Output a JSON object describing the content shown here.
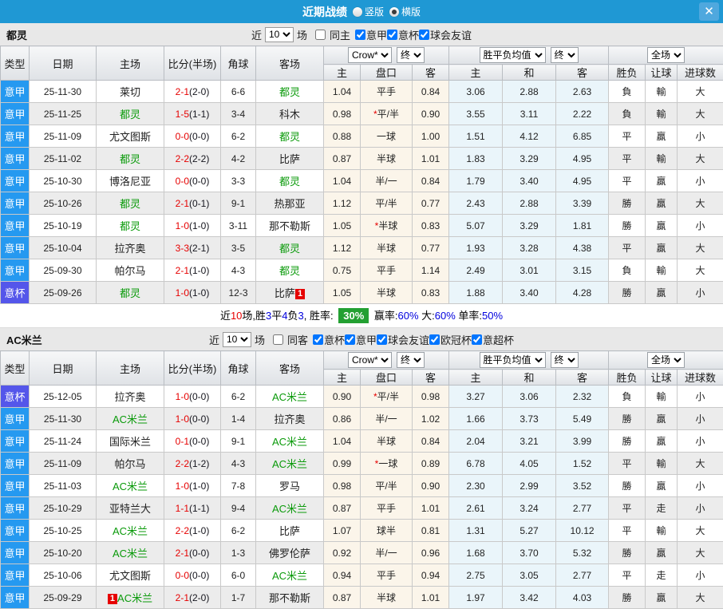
{
  "titlebar": {
    "title": "近期战绩",
    "radio_vertical": "竖版",
    "radio_horizontal": "横版",
    "close_glyph": "✕"
  },
  "table_header": {
    "type": "类型",
    "date": "日期",
    "home": "主场",
    "score": "比分(半场)",
    "corner": "角球",
    "away": "客场",
    "odds_source": "Crow*",
    "odds_final": "终",
    "mean_source": "胜平负均值",
    "mean_final": "终",
    "period": "全场",
    "odds_home": "主",
    "odds_handicap": "盘口",
    "odds_away": "客",
    "mean_home": "主",
    "mean_draw": "和",
    "mean_away": "客",
    "wdl": "胜负",
    "handicap": "让球",
    "goals": "进球数"
  },
  "colors": {
    "titlebar_blue": "#1f98d4",
    "league_badge_blue": "#2599f0",
    "cup_badge_purple": "#5456ea",
    "team_green": "#0a9a0a",
    "win_red": "#d40000",
    "draw_blue": "#2020dd",
    "lose_green": "#0a8a0a",
    "score_red": "#e60000",
    "summary_badge_green": "#23a032",
    "odds_bg": "#fbf5ea",
    "mean_bg": "#eaf5fa"
  },
  "sections": [
    {
      "team": "都灵",
      "filter": {
        "near": "近",
        "count": "10",
        "games": "场",
        "same": {
          "label": "同主",
          "checked": false
        },
        "leagues": [
          {
            "label": "意甲",
            "checked": true
          },
          {
            "label": "意杯",
            "checked": true
          },
          {
            "label": "球会友谊",
            "checked": true
          }
        ]
      },
      "rows": [
        {
          "type": "意甲",
          "type_style": "league",
          "date": "25-11-30",
          "home": "莱切",
          "home_self": false,
          "home_badge": null,
          "score": "2-1",
          "half": "(2-0)",
          "corner": "6-6",
          "away": "都灵",
          "away_self": true,
          "away_badge": null,
          "odds_home": "1.04",
          "handicap": "平手",
          "star": false,
          "odds_away": "0.84",
          "mean_home": "3.06",
          "mean_draw": "2.88",
          "mean_away": "2.63",
          "res_wdl": "負",
          "res_wdl_color": "g",
          "res_hcap": "輸",
          "res_hcap_color": "g",
          "res_goal": "大",
          "res_goal_color": "r"
        },
        {
          "type": "意甲",
          "type_style": "league",
          "date": "25-11-25",
          "home": "都灵",
          "home_self": true,
          "home_badge": null,
          "score": "1-5",
          "half": "(1-1)",
          "corner": "3-4",
          "away": "科木",
          "away_self": false,
          "away_badge": null,
          "odds_home": "0.98",
          "handicap": "平/半",
          "star": true,
          "odds_away": "0.90",
          "mean_home": "3.55",
          "mean_draw": "3.11",
          "mean_away": "2.22",
          "res_wdl": "負",
          "res_wdl_color": "g",
          "res_hcap": "輸",
          "res_hcap_color": "g",
          "res_goal": "大",
          "res_goal_color": "r"
        },
        {
          "type": "意甲",
          "type_style": "league",
          "date": "25-11-09",
          "home": "尤文图斯",
          "home_self": false,
          "home_badge": null,
          "score": "0-0",
          "half": "(0-0)",
          "corner": "6-2",
          "away": "都灵",
          "away_self": true,
          "away_badge": null,
          "odds_home": "0.88",
          "handicap": "一球",
          "star": false,
          "odds_away": "1.00",
          "mean_home": "1.51",
          "mean_draw": "4.12",
          "mean_away": "6.85",
          "res_wdl": "平",
          "res_wdl_color": "b",
          "res_hcap": "贏",
          "res_hcap_color": "r",
          "res_goal": "小",
          "res_goal_color": "g"
        },
        {
          "type": "意甲",
          "type_style": "league",
          "date": "25-11-02",
          "home": "都灵",
          "home_self": true,
          "home_badge": null,
          "score": "2-2",
          "half": "(2-2)",
          "corner": "4-2",
          "away": "比萨",
          "away_self": false,
          "away_badge": null,
          "odds_home": "0.87",
          "handicap": "半球",
          "star": false,
          "odds_away": "1.01",
          "mean_home": "1.83",
          "mean_draw": "3.29",
          "mean_away": "4.95",
          "res_wdl": "平",
          "res_wdl_color": "b",
          "res_hcap": "輸",
          "res_hcap_color": "g",
          "res_goal": "大",
          "res_goal_color": "r"
        },
        {
          "type": "意甲",
          "type_style": "league",
          "date": "25-10-30",
          "home": "博洛尼亚",
          "home_self": false,
          "home_badge": null,
          "score": "0-0",
          "half": "(0-0)",
          "corner": "3-3",
          "away": "都灵",
          "away_self": true,
          "away_badge": null,
          "odds_home": "1.04",
          "handicap": "半/一",
          "star": false,
          "odds_away": "0.84",
          "mean_home": "1.79",
          "mean_draw": "3.40",
          "mean_away": "4.95",
          "res_wdl": "平",
          "res_wdl_color": "b",
          "res_hcap": "贏",
          "res_hcap_color": "r",
          "res_goal": "小",
          "res_goal_color": "g"
        },
        {
          "type": "意甲",
          "type_style": "league",
          "date": "25-10-26",
          "home": "都灵",
          "home_self": true,
          "home_badge": null,
          "score": "2-1",
          "half": "(0-1)",
          "corner": "9-1",
          "away": "热那亚",
          "away_self": false,
          "away_badge": null,
          "odds_home": "1.12",
          "handicap": "平/半",
          "star": false,
          "odds_away": "0.77",
          "mean_home": "2.43",
          "mean_draw": "2.88",
          "mean_away": "3.39",
          "res_wdl": "勝",
          "res_wdl_color": "r",
          "res_hcap": "贏",
          "res_hcap_color": "r",
          "res_goal": "大",
          "res_goal_color": "r"
        },
        {
          "type": "意甲",
          "type_style": "league",
          "date": "25-10-19",
          "home": "都灵",
          "home_self": true,
          "home_badge": null,
          "score": "1-0",
          "half": "(1-0)",
          "corner": "3-11",
          "away": "那不勒斯",
          "away_self": false,
          "away_badge": null,
          "odds_home": "1.05",
          "handicap": "半球",
          "star": true,
          "odds_away": "0.83",
          "mean_home": "5.07",
          "mean_draw": "3.29",
          "mean_away": "1.81",
          "res_wdl": "勝",
          "res_wdl_color": "r",
          "res_hcap": "贏",
          "res_hcap_color": "r",
          "res_goal": "小",
          "res_goal_color": "g"
        },
        {
          "type": "意甲",
          "type_style": "league",
          "date": "25-10-04",
          "home": "拉齐奥",
          "home_self": false,
          "home_badge": null,
          "score": "3-3",
          "half": "(2-1)",
          "corner": "3-5",
          "away": "都灵",
          "away_self": true,
          "away_badge": null,
          "odds_home": "1.12",
          "handicap": "半球",
          "star": false,
          "odds_away": "0.77",
          "mean_home": "1.93",
          "mean_draw": "3.28",
          "mean_away": "4.38",
          "res_wdl": "平",
          "res_wdl_color": "b",
          "res_hcap": "贏",
          "res_hcap_color": "r",
          "res_goal": "大",
          "res_goal_color": "r"
        },
        {
          "type": "意甲",
          "type_style": "league",
          "date": "25-09-30",
          "home": "帕尔马",
          "home_self": false,
          "home_badge": null,
          "score": "2-1",
          "half": "(1-0)",
          "corner": "4-3",
          "away": "都灵",
          "away_self": true,
          "away_badge": null,
          "odds_home": "0.75",
          "handicap": "平手",
          "star": false,
          "odds_away": "1.14",
          "mean_home": "2.49",
          "mean_draw": "3.01",
          "mean_away": "3.15",
          "res_wdl": "負",
          "res_wdl_color": "g",
          "res_hcap": "輸",
          "res_hcap_color": "g",
          "res_goal": "大",
          "res_goal_color": "r"
        },
        {
          "type": "意杯",
          "type_style": "cup",
          "date": "25-09-26",
          "home": "都灵",
          "home_self": true,
          "home_badge": null,
          "score": "1-0",
          "half": "(1-0)",
          "corner": "12-3",
          "away": "比萨",
          "away_self": false,
          "away_badge": {
            "text": "1",
            "pos": "after"
          },
          "odds_home": "1.05",
          "handicap": "半球",
          "star": false,
          "odds_away": "0.83",
          "mean_home": "1.88",
          "mean_draw": "3.40",
          "mean_away": "4.28",
          "res_wdl": "勝",
          "res_wdl_color": "r",
          "res_hcap": "贏",
          "res_hcap_color": "r",
          "res_goal": "小",
          "res_goal_color": "g"
        }
      ],
      "summary": {
        "segments": [
          {
            "text": "近",
            "color": "black"
          },
          {
            "text": "10",
            "color": "red"
          },
          {
            "text": "场,胜",
            "color": "black"
          },
          {
            "text": "3",
            "color": "blue"
          },
          {
            "text": "平",
            "color": "black"
          },
          {
            "text": "4",
            "color": "blue"
          },
          {
            "text": "负",
            "color": "black"
          },
          {
            "text": "3",
            "color": "blue"
          },
          {
            "text": ", 胜率: ",
            "color": "black"
          },
          {
            "text": "30%",
            "color": "badge"
          },
          {
            "text": " 赢率:",
            "color": "black"
          },
          {
            "text": "60%",
            "color": "blue"
          },
          {
            "text": " 大:",
            "color": "black"
          },
          {
            "text": "60%",
            "color": "blue"
          },
          {
            "text": " 单率:",
            "color": "black"
          },
          {
            "text": "50%",
            "color": "blue"
          }
        ]
      }
    },
    {
      "team": "AC米兰",
      "filter": {
        "near": "近",
        "count": "10",
        "games": "场",
        "same": {
          "label": "同客",
          "checked": false
        },
        "leagues": [
          {
            "label": "意杯",
            "checked": true
          },
          {
            "label": "意甲",
            "checked": true
          },
          {
            "label": "球会友谊",
            "checked": true
          },
          {
            "label": "欧冠杯",
            "checked": true
          },
          {
            "label": "意超杯",
            "checked": true
          }
        ]
      },
      "rows": [
        {
          "type": "意杯",
          "type_style": "cup",
          "date": "25-12-05",
          "home": "拉齐奥",
          "home_self": false,
          "home_badge": null,
          "score": "1-0",
          "half": "(0-0)",
          "corner": "6-2",
          "away": "AC米兰",
          "away_self": true,
          "away_badge": null,
          "odds_home": "0.90",
          "handicap": "平/半",
          "star": true,
          "odds_away": "0.98",
          "mean_home": "3.27",
          "mean_draw": "3.06",
          "mean_away": "2.32",
          "res_wdl": "負",
          "res_wdl_color": "g",
          "res_hcap": "輸",
          "res_hcap_color": "g",
          "res_goal": "小",
          "res_goal_color": "g"
        },
        {
          "type": "意甲",
          "type_style": "league",
          "date": "25-11-30",
          "home": "AC米兰",
          "home_self": true,
          "home_badge": null,
          "score": "1-0",
          "half": "(0-0)",
          "corner": "1-4",
          "away": "拉齐奥",
          "away_self": false,
          "away_badge": null,
          "odds_home": "0.86",
          "handicap": "半/一",
          "star": false,
          "odds_away": "1.02",
          "mean_home": "1.66",
          "mean_draw": "3.73",
          "mean_away": "5.49",
          "res_wdl": "勝",
          "res_wdl_color": "r",
          "res_hcap": "贏",
          "res_hcap_color": "r",
          "res_goal": "小",
          "res_goal_color": "g"
        },
        {
          "type": "意甲",
          "type_style": "league",
          "date": "25-11-24",
          "home": "国际米兰",
          "home_self": false,
          "home_badge": null,
          "score": "0-1",
          "half": "(0-0)",
          "corner": "9-1",
          "away": "AC米兰",
          "away_self": true,
          "away_badge": null,
          "odds_home": "1.04",
          "handicap": "半球",
          "star": false,
          "odds_away": "0.84",
          "mean_home": "2.04",
          "mean_draw": "3.21",
          "mean_away": "3.99",
          "res_wdl": "勝",
          "res_wdl_color": "r",
          "res_hcap": "贏",
          "res_hcap_color": "r",
          "res_goal": "小",
          "res_goal_color": "g"
        },
        {
          "type": "意甲",
          "type_style": "league",
          "date": "25-11-09",
          "home": "帕尔马",
          "home_self": false,
          "home_badge": null,
          "score": "2-2",
          "half": "(1-2)",
          "corner": "4-3",
          "away": "AC米兰",
          "away_self": true,
          "away_badge": null,
          "odds_home": "0.99",
          "handicap": "一球",
          "star": true,
          "odds_away": "0.89",
          "mean_home": "6.78",
          "mean_draw": "4.05",
          "mean_away": "1.52",
          "res_wdl": "平",
          "res_wdl_color": "b",
          "res_hcap": "輸",
          "res_hcap_color": "g",
          "res_goal": "大",
          "res_goal_color": "r"
        },
        {
          "type": "意甲",
          "type_style": "league",
          "date": "25-11-03",
          "home": "AC米兰",
          "home_self": true,
          "home_badge": null,
          "score": "1-0",
          "half": "(1-0)",
          "corner": "7-8",
          "away": "罗马",
          "away_self": false,
          "away_badge": null,
          "odds_home": "0.98",
          "handicap": "平/半",
          "star": false,
          "odds_away": "0.90",
          "mean_home": "2.30",
          "mean_draw": "2.99",
          "mean_away": "3.52",
          "res_wdl": "勝",
          "res_wdl_color": "r",
          "res_hcap": "贏",
          "res_hcap_color": "r",
          "res_goal": "小",
          "res_goal_color": "g"
        },
        {
          "type": "意甲",
          "type_style": "league",
          "date": "25-10-29",
          "home": "亚特兰大",
          "home_self": false,
          "home_badge": null,
          "score": "1-1",
          "half": "(1-1)",
          "corner": "9-4",
          "away": "AC米兰",
          "away_self": true,
          "away_badge": null,
          "odds_home": "0.87",
          "handicap": "平手",
          "star": false,
          "odds_away": "1.01",
          "mean_home": "2.61",
          "mean_draw": "3.24",
          "mean_away": "2.77",
          "res_wdl": "平",
          "res_wdl_color": "b",
          "res_hcap": "走",
          "res_hcap_color": "b",
          "res_goal": "小",
          "res_goal_color": "g"
        },
        {
          "type": "意甲",
          "type_style": "league",
          "date": "25-10-25",
          "home": "AC米兰",
          "home_self": true,
          "home_badge": null,
          "score": "2-2",
          "half": "(1-0)",
          "corner": "6-2",
          "away": "比萨",
          "away_self": false,
          "away_badge": null,
          "odds_home": "1.07",
          "handicap": "球半",
          "star": false,
          "odds_away": "0.81",
          "mean_home": "1.31",
          "mean_draw": "5.27",
          "mean_away": "10.12",
          "res_wdl": "平",
          "res_wdl_color": "b",
          "res_hcap": "輸",
          "res_hcap_color": "g",
          "res_goal": "大",
          "res_goal_color": "r"
        },
        {
          "type": "意甲",
          "type_style": "league",
          "date": "25-10-20",
          "home": "AC米兰",
          "home_self": true,
          "home_badge": null,
          "score": "2-1",
          "half": "(0-0)",
          "corner": "1-3",
          "away": "佛罗伦萨",
          "away_self": false,
          "away_badge": null,
          "odds_home": "0.92",
          "handicap": "半/一",
          "star": false,
          "odds_away": "0.96",
          "mean_home": "1.68",
          "mean_draw": "3.70",
          "mean_away": "5.32",
          "res_wdl": "勝",
          "res_wdl_color": "r",
          "res_hcap": "贏",
          "res_hcap_color": "r",
          "res_goal": "大",
          "res_goal_color": "r"
        },
        {
          "type": "意甲",
          "type_style": "league",
          "date": "25-10-06",
          "home": "尤文图斯",
          "home_self": false,
          "home_badge": null,
          "score": "0-0",
          "half": "(0-0)",
          "corner": "6-0",
          "away": "AC米兰",
          "away_self": true,
          "away_badge": null,
          "odds_home": "0.94",
          "handicap": "平手",
          "star": false,
          "odds_away": "0.94",
          "mean_home": "2.75",
          "mean_draw": "3.05",
          "mean_away": "2.77",
          "res_wdl": "平",
          "res_wdl_color": "b",
          "res_hcap": "走",
          "res_hcap_color": "b",
          "res_goal": "小",
          "res_goal_color": "g"
        },
        {
          "type": "意甲",
          "type_style": "league",
          "date": "25-09-29",
          "home": "AC米兰",
          "home_self": true,
          "home_badge": {
            "text": "1",
            "pos": "before"
          },
          "score": "2-1",
          "half": "(2-0)",
          "corner": "1-7",
          "away": "那不勒斯",
          "away_self": false,
          "away_badge": null,
          "odds_home": "0.87",
          "handicap": "半球",
          "star": false,
          "odds_away": "1.01",
          "mean_home": "1.97",
          "mean_draw": "3.42",
          "mean_away": "4.03",
          "res_wdl": "勝",
          "res_wdl_color": "r",
          "res_hcap": "贏",
          "res_hcap_color": "r",
          "res_goal": "大",
          "res_goal_color": "r"
        }
      ],
      "summary": null
    }
  ]
}
